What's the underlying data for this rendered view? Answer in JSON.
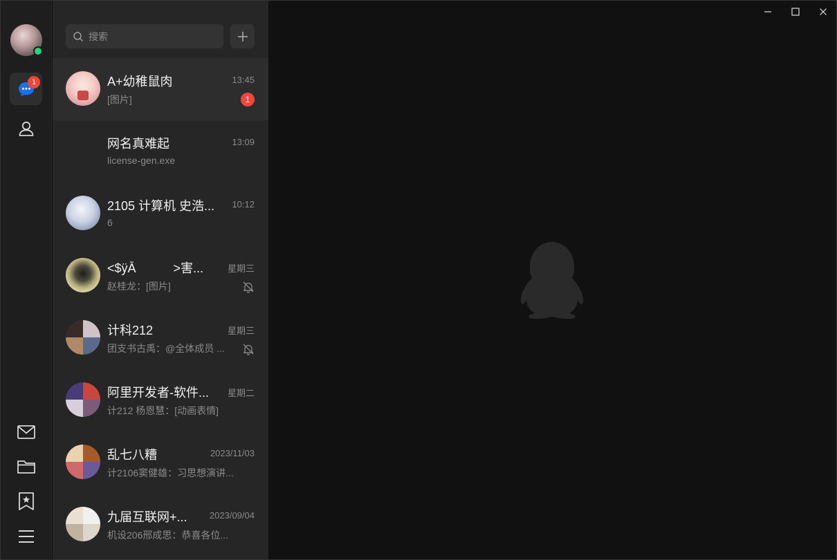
{
  "app": {
    "title": "QQ"
  },
  "rail": {
    "avatar_status": "online",
    "messages_badge": "1",
    "icons": [
      "message-icon",
      "contacts-icon",
      "mail-icon",
      "folder-icon",
      "favorites-icon",
      "menu-icon"
    ]
  },
  "search": {
    "placeholder": "搜索"
  },
  "conversations": [
    {
      "name": "A+幼稚鼠肉",
      "time": "13:45",
      "preview": "[图片]",
      "unread": "1",
      "muted": false
    },
    {
      "name": "网名真难起",
      "time": "13:09",
      "preview": "license-gen.exe",
      "unread": "",
      "muted": false
    },
    {
      "name": "2105 计算机 史浩...",
      "time": "10:12",
      "preview": "6",
      "unread": "",
      "muted": false
    },
    {
      "name": "<$ÿĀ　　　>害...",
      "time": "星期三",
      "preview": "赵桂龙：[图片]",
      "unread": "",
      "muted": true
    },
    {
      "name": "计科212",
      "time": "星期三",
      "preview": "团支书古禹：@全体成员 ...",
      "unread": "",
      "muted": true
    },
    {
      "name": "阿里开发者-软件...",
      "time": "星期二",
      "preview": "计212 杨恩慧：[动画表情]",
      "unread": "",
      "muted": false
    },
    {
      "name": "乱七八糟",
      "time": "2023/11/03",
      "preview": "计2106窦健雄：习思想演讲...",
      "unread": "",
      "muted": false
    },
    {
      "name": "九届互联网+...",
      "time": "2023/09/04",
      "preview": "机设206邢成思：恭喜各位...",
      "unread": "",
      "muted": false
    }
  ],
  "colors": {
    "accent": "#1e6fe8",
    "badge": "#f2463c",
    "online": "#2cd27a"
  }
}
